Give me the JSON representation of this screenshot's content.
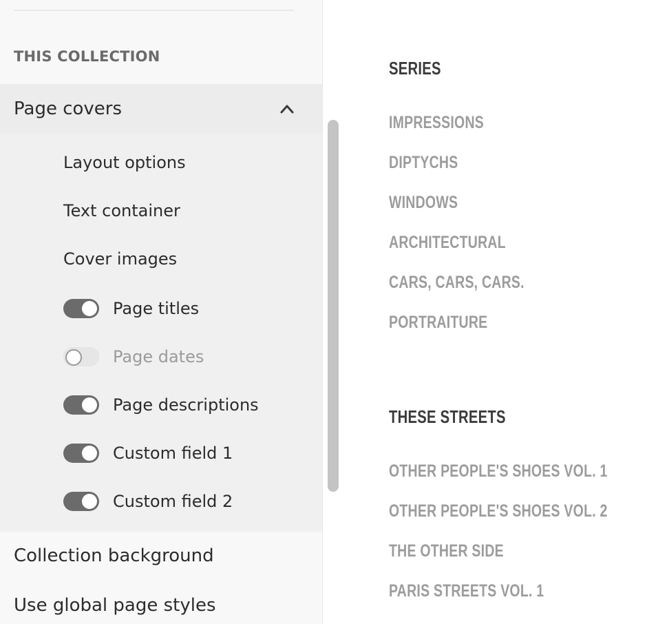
{
  "sidebar": {
    "section_label": "THIS COLLECTION",
    "group": {
      "label": "Page covers",
      "items": [
        {
          "label": "Layout options"
        },
        {
          "label": "Text container"
        },
        {
          "label": "Cover images"
        }
      ],
      "toggles": [
        {
          "label": "Page titles",
          "on": true
        },
        {
          "label": "Page dates",
          "on": false
        },
        {
          "label": "Page descriptions",
          "on": true
        },
        {
          "label": "Custom field 1",
          "on": true
        },
        {
          "label": "Custom field 2",
          "on": true
        }
      ]
    },
    "menu": [
      {
        "label": "Collection background"
      },
      {
        "label": "Use global page styles"
      }
    ]
  },
  "preview": {
    "sections": [
      {
        "heading": "SERIES",
        "links": [
          "IMPRESSIONS",
          "DIPTYCHS",
          "WINDOWS",
          "ARCHITECTURAL",
          "CARS, CARS, CARS.",
          "PORTRAITURE"
        ]
      },
      {
        "heading": "THESE STREETS",
        "links": [
          "OTHER PEOPLE'S SHOES VOL. 1",
          "OTHER PEOPLE'S SHOES VOL. 2",
          "THE OTHER SIDE",
          "PARIS STREETS VOL. 1"
        ]
      }
    ]
  },
  "colors": {
    "toggle_on": "#6b6b6b",
    "toggle_off": "#e6e6e6",
    "heading_text": "#3b3b3b",
    "link_text": "#9c9c9c"
  }
}
